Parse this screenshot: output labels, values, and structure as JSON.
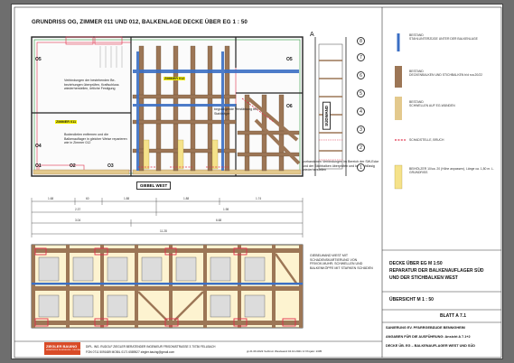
{
  "sheet_title": "GRUNDRISS OG, ZIMMER 011 UND 012,   BALKENLAGE DECKE ÜBER EG   1 : 50",
  "room_labels": {
    "room_012": "ZIMMER 012",
    "room_011": "ZIMMER 011"
  },
  "notes": {
    "connections": "Verbindungen der bestehenden Be- beziehungen überprüfen, Kraftschluss wiederherstellen, örtliche Festigung",
    "floors": "Bodendielen entfernen und die Balkenauflager in gleicher Weise reparieren wie in Zimmer 012",
    "deformation": "begradigende Verstärkung bei Stahlträger",
    "existing": "vorhandenen Verbindungen im Bereich der SW-Ecke und der Stichbalken überprüfen und kraftschlüssig wiederherstellen",
    "gable_wall": "GIEBELWAND WEST MIT SCHADENSKARTIERUNG VON FRIVOK.MUHR; SCHWELLEN UND BALKENKÖPFE MIT STARKEN SCHÄDEN"
  },
  "section_labels": {
    "gable_west": "GIEBEL WEST",
    "south_wall": "SÜDWAND",
    "axis_A": "A"
  },
  "axis_numbers": [
    "8",
    "7",
    "6",
    "5",
    "4",
    "3",
    "2",
    "1"
  ],
  "room_codes": [
    "O5",
    "O4",
    "O1",
    "O2",
    "O3",
    "O5",
    "O6"
  ],
  "dimensions": {
    "row1": [
      "1.68",
      "60",
      "1.88",
      "1.88",
      "1.74"
    ],
    "row2": [
      "2.37",
      "1.98"
    ],
    "row3": [
      "3.04",
      "6.68"
    ],
    "total": "11.28"
  },
  "legend": {
    "steel": {
      "label": "BESTAND",
      "desc": "STAHLUNTERZÜGE UNTER DER BALKENLAGE",
      "color": "#3b6fc4"
    },
    "beams": {
      "label": "BESTAND",
      "desc": "DECKENBALKEN UND STICHBALKEN b/d rca.20/22",
      "color": "#9c7656"
    },
    "sills": {
      "label": "BESTAND",
      "desc": "SCHWELLEN AUF EG-WÄNDEN",
      "color": "#e3c98d"
    },
    "damage": {
      "desc": "SCHADSTELLE, BRUCH",
      "color": "#e0304a"
    },
    "new": {
      "desc": "BEIHÖLZER 10/ca. 20 (Höhe anpassen), Länge ca. 1,80 m. L. GRUNDRISS",
      "color": "#f5e28a"
    }
  },
  "title_block": {
    "line1": "DECKE ÜBER EG   M 1:50",
    "line2": "REPARATUR DER BALKENAUFLAGER SÜD",
    "line3": "UND DER STICHBALKEN WEST",
    "overview": "ÜBERSICHT      M 1 : 50",
    "sheet_no": "BLATT   A 7.1",
    "project1": "SANIERUNG EV. PFARRGEBÄUDE  BENNIGHEIM",
    "project2": "ANGABEN FÜR DIE AUSFÜHRUNG:   Ansicht  A 7.1+2",
    "project3": "DECKE ÜB. EG – BALKENAUFLAGER WEST UND SÜD"
  },
  "footer": {
    "company": "ZIEGLER BAUING",
    "company_sub": "BERATENDE INGENIEURE · FELLBACH",
    "address": "DIPL. ING. RUDOLF ZIEGLER   BERATENDER INGENIEUR   FRISONISTRASSE 3   70736 FELLBACH",
    "contact": "FON  0711 5091689   MOBIL  0171 6589527   ziegler.bauing@gmail.com",
    "date_line": "gt 21.09.2022  Verbind. Westwand   04.10.2021 zz      Projekt:  1305"
  },
  "colors": {
    "steel": "#3b6fc4",
    "beam": "#9c7656",
    "sill": "#e3c98d",
    "damage": "#e0304a",
    "plan_red": "#e0304a"
  }
}
